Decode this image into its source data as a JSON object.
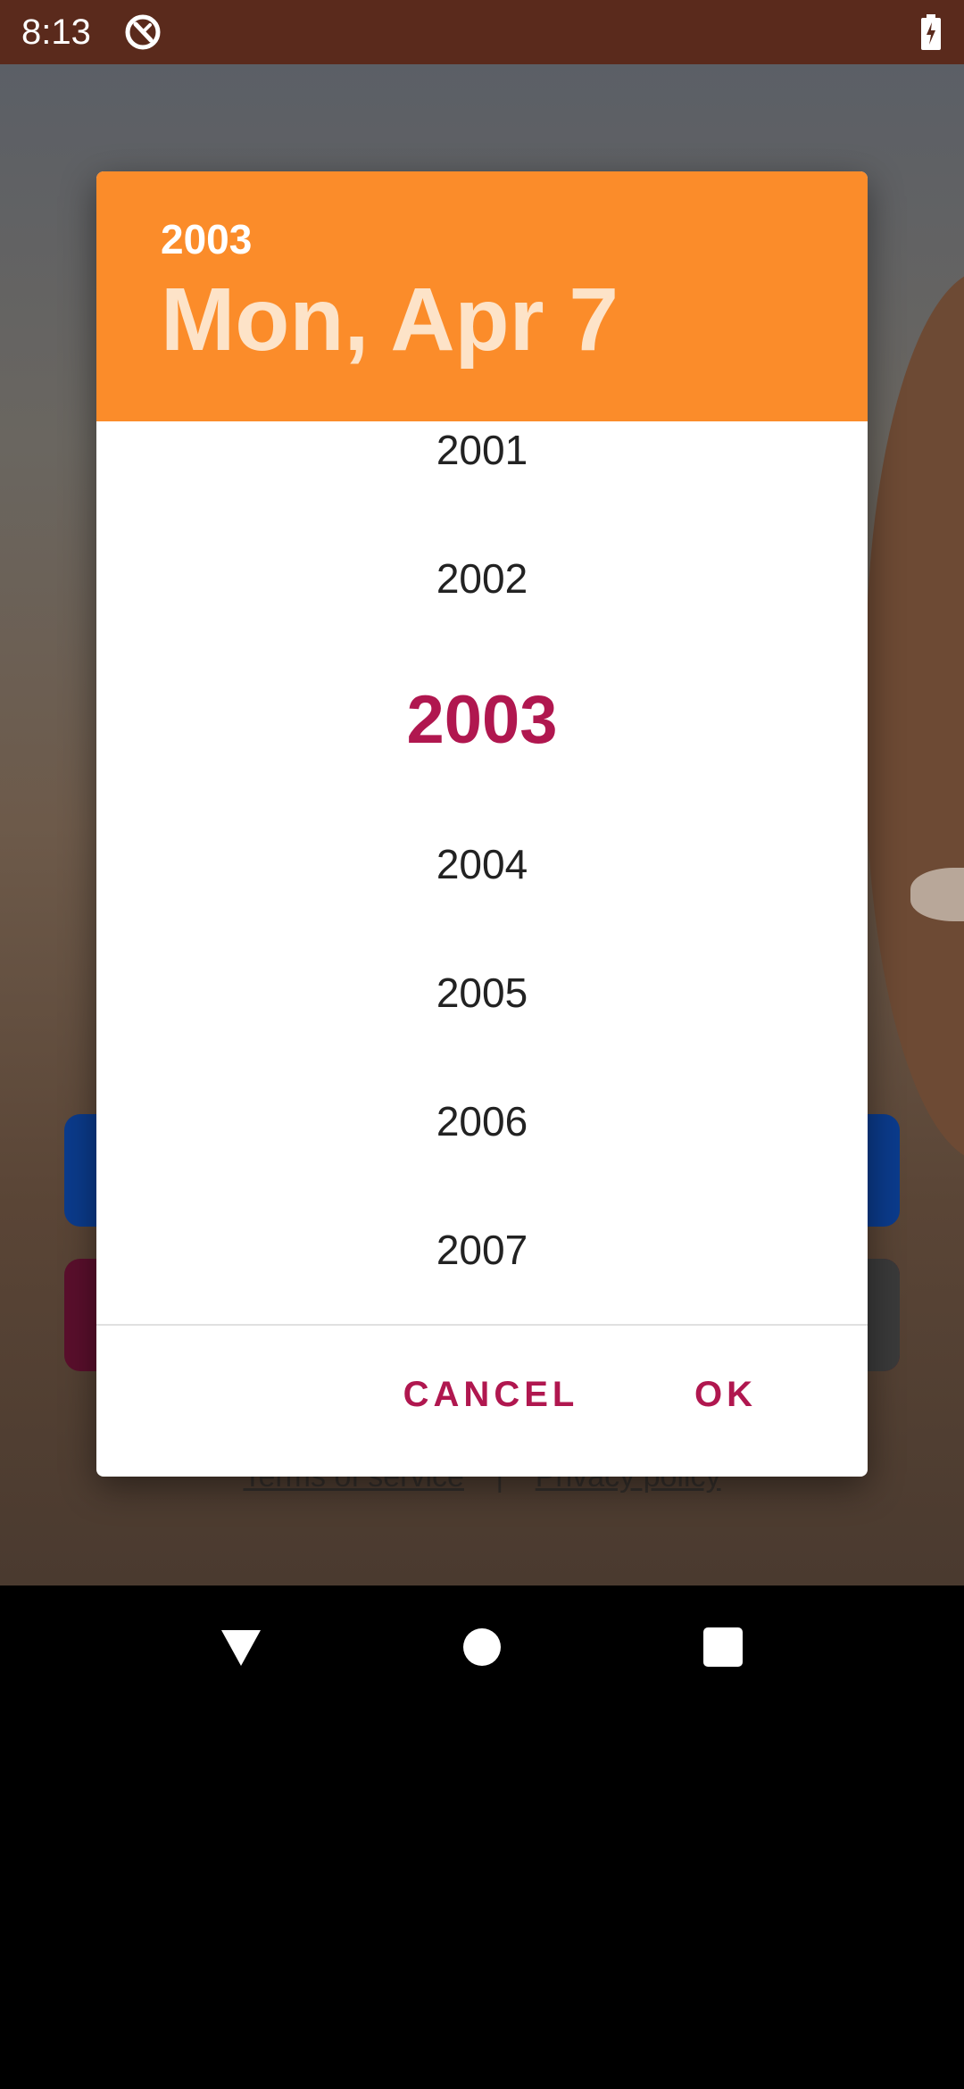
{
  "status_bar": {
    "time": "8:13",
    "app_icon": "sync-circle-icon",
    "battery_icon": "battery-charging-icon"
  },
  "background_app": {
    "footer_links": {
      "terms": "Terms of service",
      "separator": "|",
      "privacy": "Privacy policy"
    }
  },
  "date_dialog": {
    "header_color": "#fb8c2a",
    "accent_color": "#b0174f",
    "selected_year": "2003",
    "selected_date": "Mon, Apr 7",
    "years": [
      {
        "label": "2001",
        "selected": false
      },
      {
        "label": "2002",
        "selected": false
      },
      {
        "label": "2003",
        "selected": true
      },
      {
        "label": "2004",
        "selected": false
      },
      {
        "label": "2005",
        "selected": false
      },
      {
        "label": "2006",
        "selected": false
      },
      {
        "label": "2007",
        "selected": false
      }
    ],
    "cancel_label": "CANCEL",
    "ok_label": "OK"
  },
  "nav_bar": {
    "back_icon": "back-triangle-icon",
    "home_icon": "home-circle-icon",
    "recents_icon": "recents-square-icon"
  }
}
